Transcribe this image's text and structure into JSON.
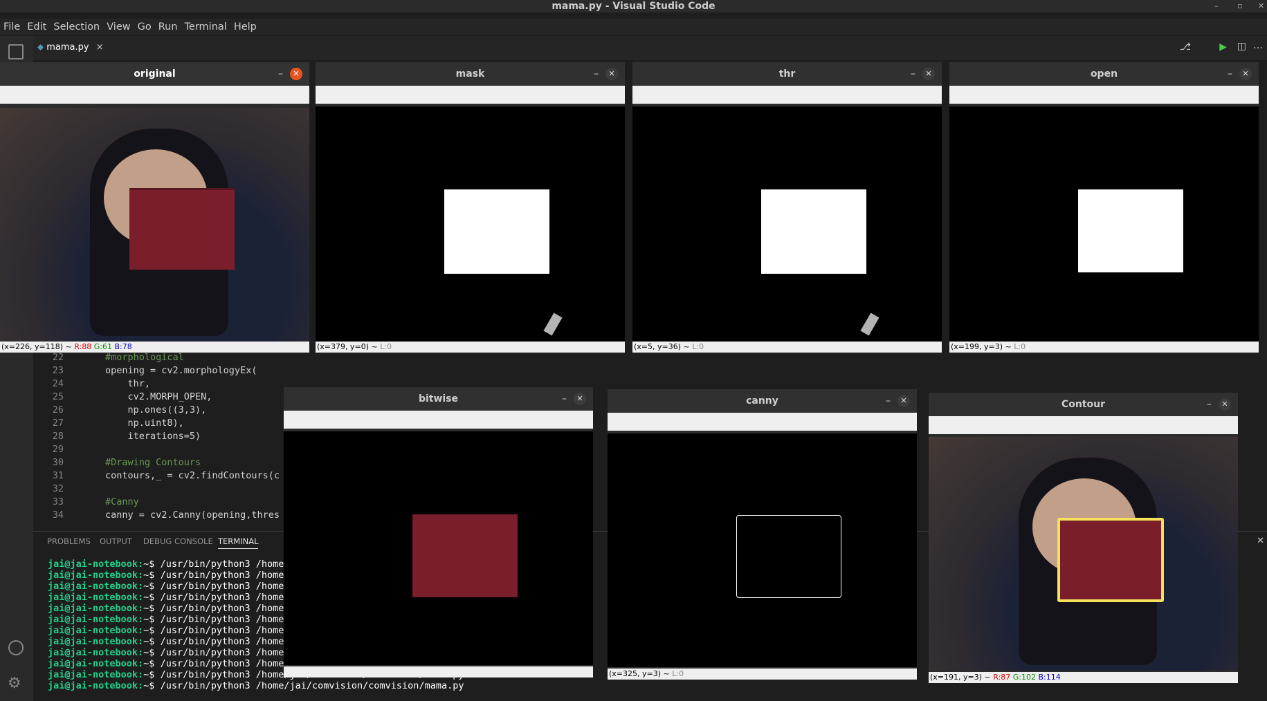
{
  "window_title": "mama.py - Visual Studio Code",
  "menu": [
    "File",
    "Edit",
    "Selection",
    "View",
    "Go",
    "Run",
    "Terminal",
    "Help"
  ],
  "tab": {
    "label": "mama.py",
    "close": "×"
  },
  "code_lines": [
    {
      "n": "22",
      "text": "#morphological",
      "comment": true
    },
    {
      "n": "23",
      "text": "opening = cv2.morphologyEx(",
      "comment": false
    },
    {
      "n": "24",
      "text": "    thr,",
      "comment": false
    },
    {
      "n": "25",
      "text": "    cv2.MORPH_OPEN,",
      "comment": false
    },
    {
      "n": "26",
      "text": "    np.ones((3,3),",
      "comment": false
    },
    {
      "n": "27",
      "text": "    np.uint8),",
      "comment": false
    },
    {
      "n": "28",
      "text": "    iterations=5)",
      "comment": false
    },
    {
      "n": "29",
      "text": "",
      "comment": false
    },
    {
      "n": "30",
      "text": "#Drawing Contours",
      "comment": true
    },
    {
      "n": "31",
      "text": "contours,_ = cv2.findContours(c",
      "comment": false
    },
    {
      "n": "32",
      "text": "",
      "comment": false
    },
    {
      "n": "33",
      "text": "#Canny",
      "comment": true
    },
    {
      "n": "34",
      "text": "canny = cv2.Canny(opening,thres",
      "comment": false
    }
  ],
  "panel_tabs": [
    "PROBLEMS",
    "OUTPUT",
    "DEBUG CONSOLE",
    "TERMINAL"
  ],
  "terminal": {
    "prompt": "jai@jai-notebook:",
    "sym": "~$",
    "lines": [
      " /usr/bin/python3 /home/",
      " /usr/bin/python3 /home/",
      " /usr/bin/python3 /home/",
      " /usr/bin/python3 /home/",
      " /usr/bin/python3 /home/",
      " /usr/bin/python3 /home/",
      " /usr/bin/python3 /home/",
      " /usr/bin/python3 /home/",
      " /usr/bin/python3 /home/",
      " /usr/bin/python3 /home/",
      " /usr/bin/python3 /home/jai/comvision/comvision/mama.py",
      " /usr/bin/python3 /home/jai/comvision/comvision/mama.py"
    ]
  },
  "windows": {
    "original": {
      "title": "original",
      "status": "(x=226, y=118) ~ ",
      "r": "R:88",
      "g": "G:61",
      "b": "B:78"
    },
    "mask": {
      "title": "mask",
      "status": "(x=379, y=0) ~ ",
      "l": "L:0"
    },
    "thr": {
      "title": "thr",
      "status": "(x=5, y=36) ~ ",
      "l": "L:0"
    },
    "open": {
      "title": "open",
      "status": "(x=199, y=3) ~ ",
      "l": "L:0"
    },
    "bitwise": {
      "title": "bitwise"
    },
    "canny": {
      "title": "canny",
      "status": "(x=325, y=3) ~ ",
      "l": "L:0"
    },
    "contour": {
      "title": "Contour",
      "status": "(x=191, y=3) ~ ",
      "r": "R:87",
      "g": "G:102",
      "b": "B:114"
    }
  },
  "colors": {
    "box_red": "#7a1e2c",
    "contour_yellow": "#f5e25a",
    "terminal_green": "#23d18b"
  }
}
